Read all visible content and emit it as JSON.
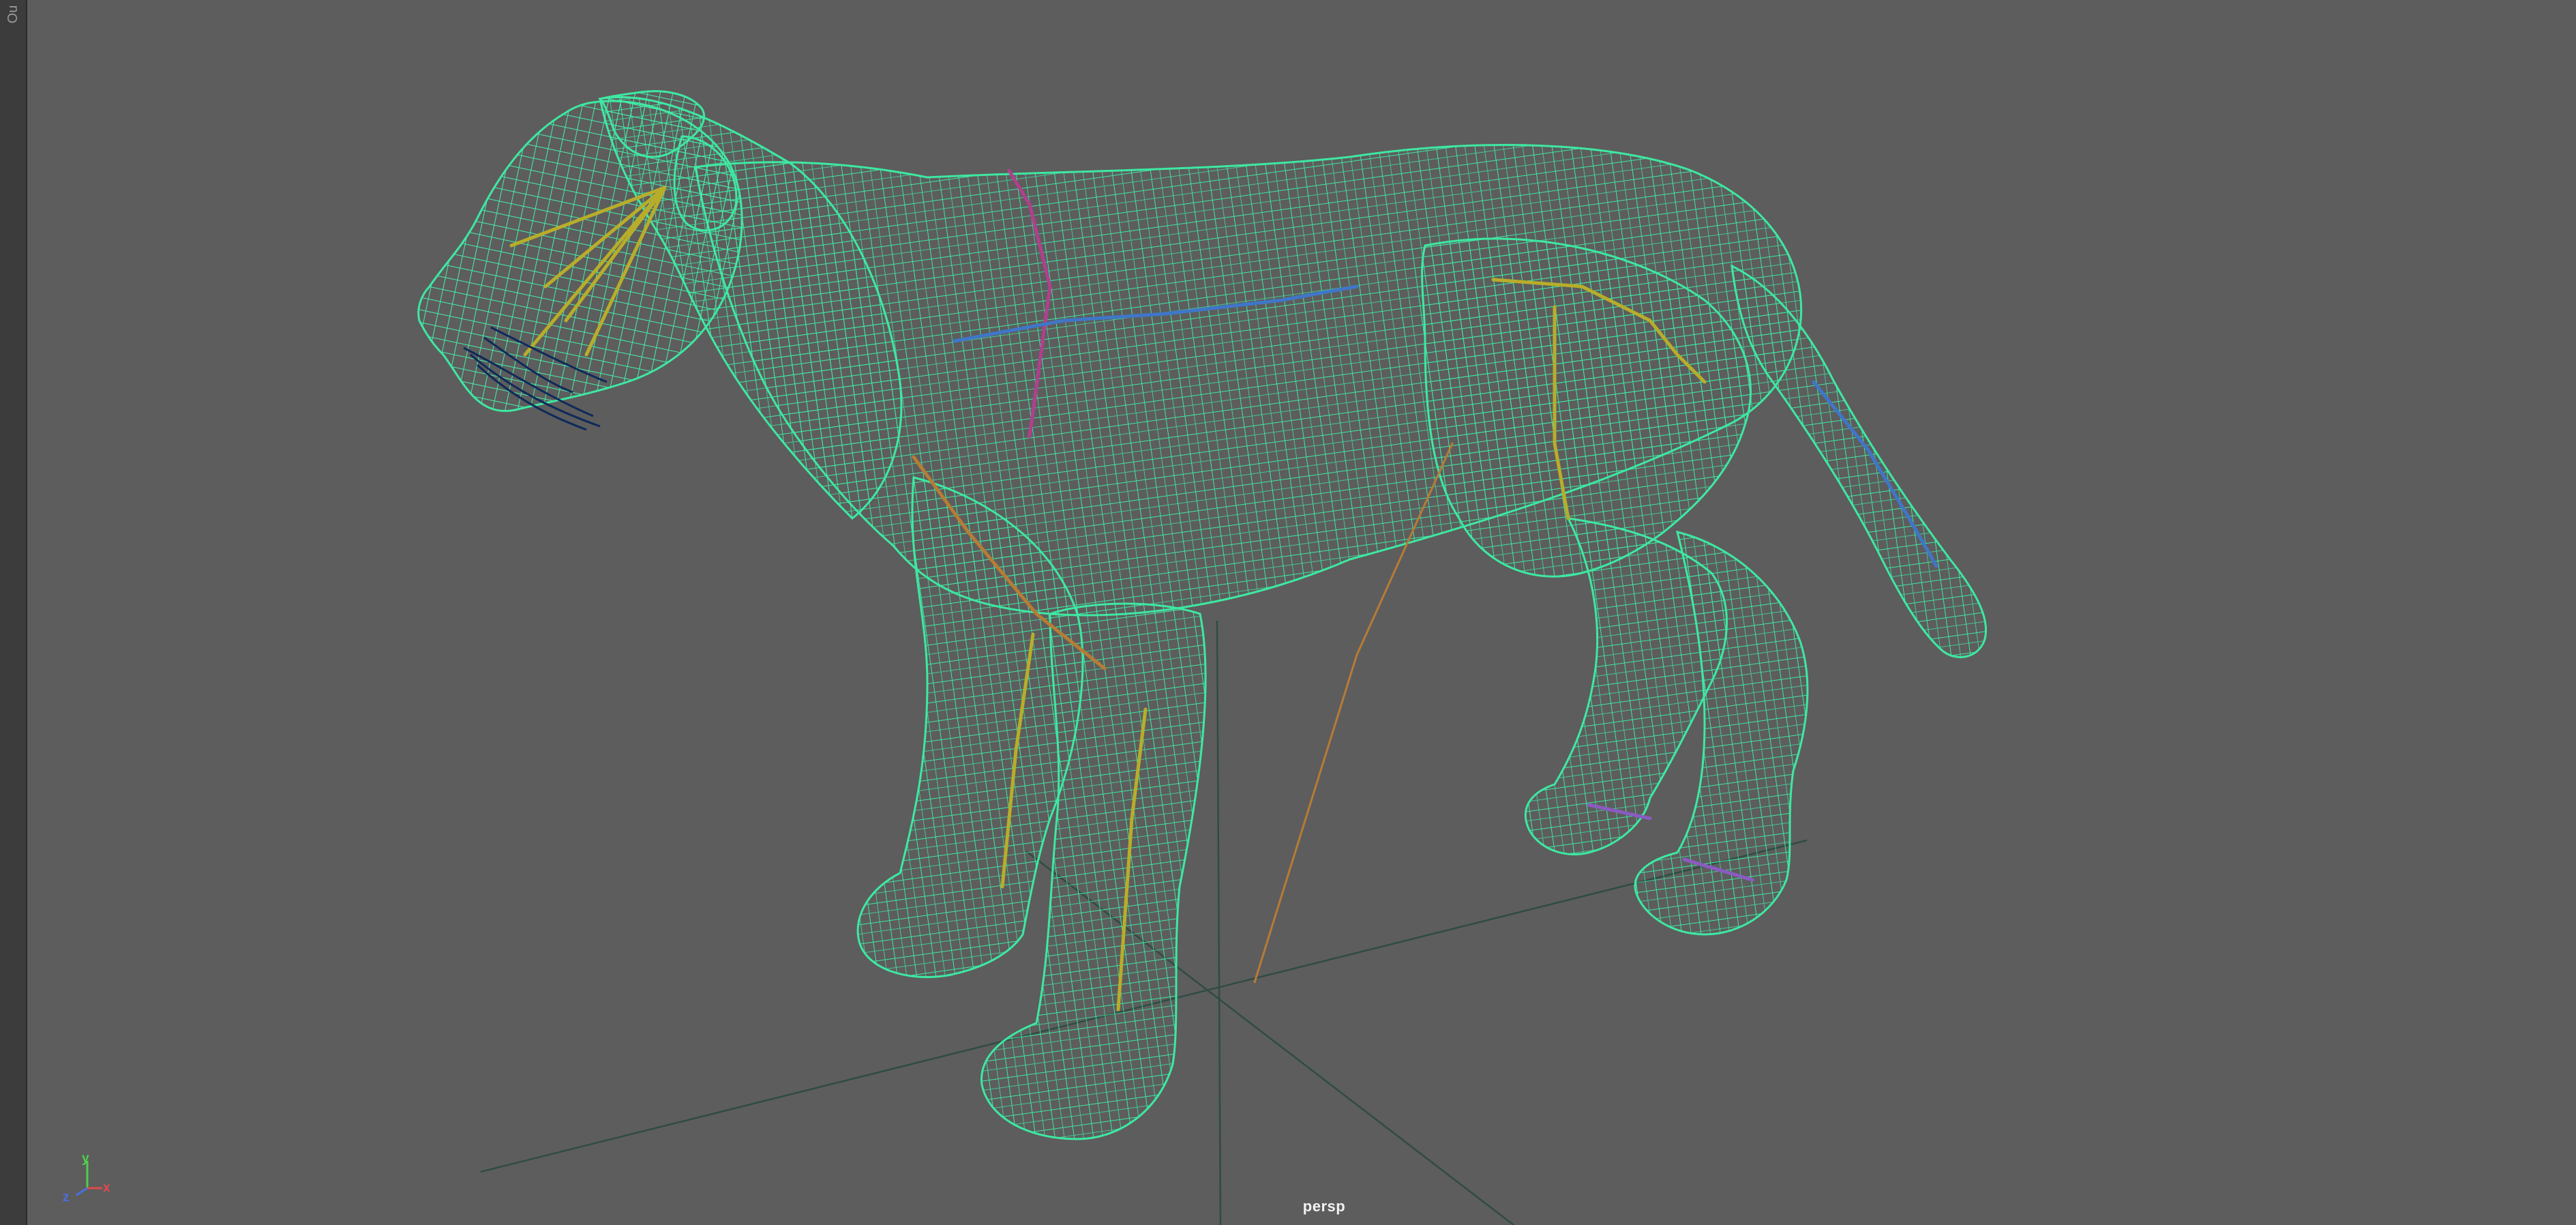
{
  "outliner_tab": {
    "label": "Ou"
  },
  "viewport": {
    "camera_label": "persp",
    "axis_gizmo": {
      "x_label": "x",
      "y_label": "y",
      "z_label": "z"
    }
  },
  "colors": {
    "viewport_bg": "#5d5d5d",
    "wireframe": "#3ee8a2",
    "joints_yellow": "#b8ad2a",
    "joints_orange": "#b67c35",
    "joints_magenta": "#b0408d",
    "joints_blue": "#3f76c8",
    "ground_grid": "#2f4c43",
    "whiskers": "#0f2a5a"
  },
  "icons": {
    "camera": "perspective-camera",
    "axes": "xyz-axis-gizmo"
  }
}
